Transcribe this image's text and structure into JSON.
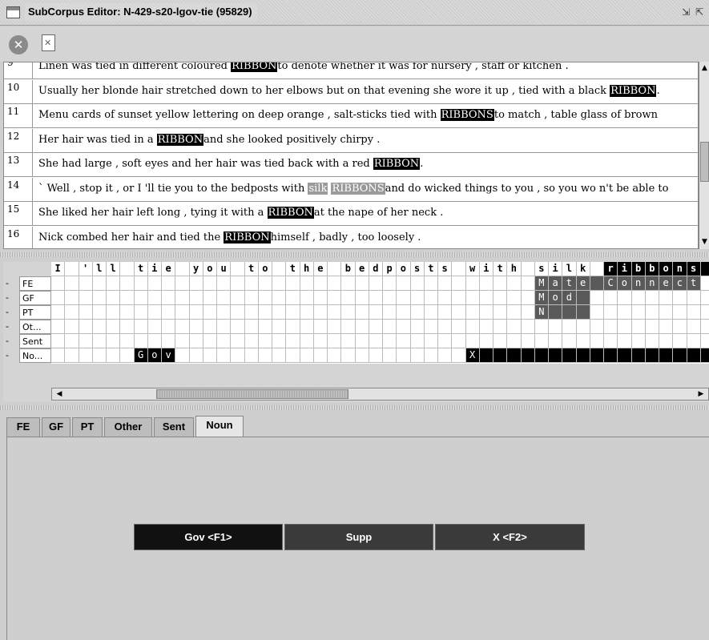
{
  "window": {
    "title": "SubCorpus Editor: N-429-s20-lgov-tie (95829)",
    "min_icon": "restore-icon",
    "max_icon": "maximize-icon"
  },
  "toolbar": {
    "close_symbol": "✕",
    "close_icon": "close-circle-icon",
    "discard_icon": "document-x-icon"
  },
  "sentences": [
    {
      "num": "9",
      "before": "Linen was tied in different coloured ",
      "target": "RIBBON",
      "after": "to denote whether it was for nursery , staff or kitchen ."
    },
    {
      "num": "10",
      "before": "Usually her blonde hair stretched down to her elbows but on that evening she wore it up , tied with a black ",
      "target": "RIBBON",
      "after": "."
    },
    {
      "num": "11",
      "before": "Menu cards of sunset yellow lettering on deep orange , salt-sticks tied with ",
      "target": "RIBBONS",
      "after": "to match , table glass of brown"
    },
    {
      "num": "12",
      "before": "Her hair was tied in a ",
      "target": "RIBBON",
      "after": "and she looked positively chirpy ."
    },
    {
      "num": "13",
      "before": "She had large , soft eyes and her hair was tied back with a red ",
      "target": "RIBBON",
      "after": "."
    },
    {
      "num": "14",
      "before": "` Well , stop it , or I 'll tie you to the bedposts with ",
      "grey": "silk",
      "target": "RIBBONS",
      "after": "and do wicked things to you , so you wo n't be able to"
    },
    {
      "num": "15",
      "before": "She liked her hair left long , tying it with a ",
      "target": "RIBBON",
      "after": "at the nape of her neck ."
    },
    {
      "num": "16",
      "before": "Nick combed her hair and tied the ",
      "target": "RIBBON",
      "after": "himself , badly , too loosely ."
    }
  ],
  "grid": {
    "header_chars": [
      "I",
      " ",
      "'",
      "l",
      "l",
      " ",
      "t",
      "i",
      "e",
      " ",
      "y",
      "o",
      "u",
      " ",
      "t",
      "o",
      " ",
      "t",
      "h",
      "e",
      " ",
      "b",
      "e",
      "d",
      "p",
      "o",
      "s",
      "t",
      "s",
      " ",
      "w",
      "i",
      "t",
      "h",
      " ",
      "s",
      "i",
      "l",
      "k",
      " ",
      "r",
      "i",
      "b",
      "b",
      "o",
      "n",
      "s"
    ],
    "layers": [
      "FE",
      "GF",
      "PT",
      "Ot...",
      "Sent",
      "No..."
    ],
    "dash": "-",
    "fe_mate": "Mate",
    "fe_connect": "Connect",
    "gf_mod": "Mod",
    "pt_n": "N",
    "noun_gov": "Gov",
    "noun_x": "X"
  },
  "tabs": [
    "FE",
    "GF",
    "PT",
    "Other",
    "Sent",
    "Noun"
  ],
  "active_tab": "Noun",
  "buttons": {
    "gov": "Gov <F1>",
    "supp": "Supp",
    "x": "X <F2>"
  },
  "colors": {
    "highlight": "#000000",
    "secondary": "#9a9a9a",
    "button_dark": "#111111",
    "button_mid": "#3a3a3a"
  }
}
